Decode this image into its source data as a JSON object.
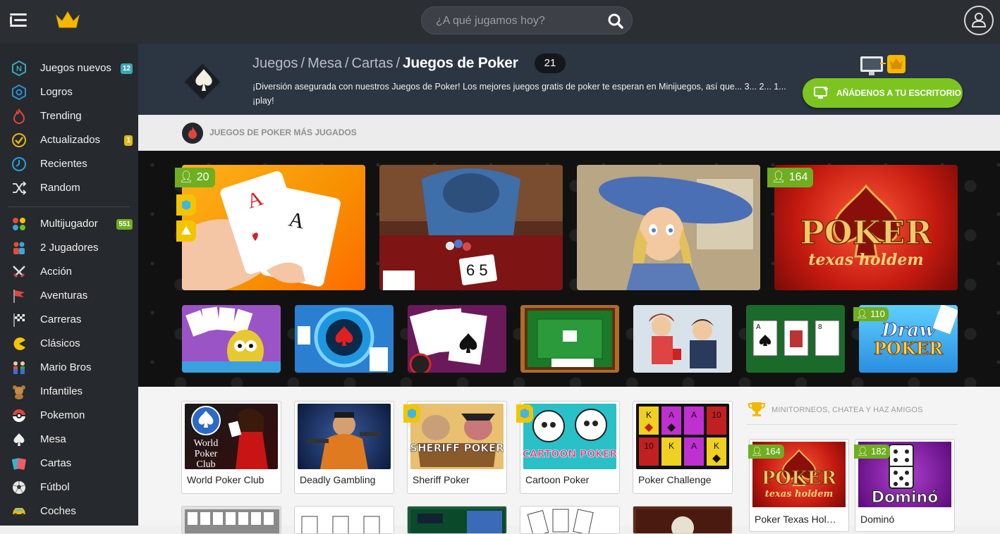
{
  "topbar": {
    "search_placeholder": "¿A qué jugamos hoy?",
    "menu_icon": "hamburger-icon",
    "logo_icon": "crown-logo-icon",
    "user_icon": "user-icon"
  },
  "sidebar": {
    "items": [
      {
        "label": "Juegos nuevos",
        "badge": "12",
        "badge_color": "#3aa7b8",
        "icon": "new-n-icon"
      },
      {
        "label": "Logros",
        "icon": "badge-icon"
      },
      {
        "label": "Trending",
        "icon": "fire-icon"
      },
      {
        "label": "Actualizados",
        "badge": "1",
        "badge_color": "#e2b816",
        "icon": "check-icon"
      },
      {
        "label": "Recientes",
        "icon": "clock-icon"
      },
      {
        "label": "Random",
        "icon": "shuffle-icon"
      },
      {
        "label": "Multijugador",
        "badge": "551",
        "badge_color": "#6fae20",
        "icon": "multiplayer-icon"
      },
      {
        "label": "2 Jugadores",
        "icon": "two-players-icon"
      },
      {
        "label": "Acción",
        "icon": "swords-icon"
      },
      {
        "label": "Aventuras",
        "icon": "flag-icon"
      },
      {
        "label": "Carreras",
        "icon": "checkered-flag-icon"
      },
      {
        "label": "Clásicos",
        "icon": "pacman-icon"
      },
      {
        "label": "Mario Bros",
        "icon": "mario-icon"
      },
      {
        "label": "Infantiles",
        "icon": "teddy-bear-icon"
      },
      {
        "label": "Pokemon",
        "icon": "pokeball-icon"
      },
      {
        "label": "Mesa",
        "icon": "spade-icon"
      },
      {
        "label": "Cartas",
        "icon": "cards-icon"
      },
      {
        "label": "Fútbol",
        "icon": "football-icon"
      },
      {
        "label": "Coches",
        "icon": "car-icon"
      }
    ]
  },
  "header": {
    "breadcrumb": [
      "Juegos",
      "Mesa",
      "Cartas"
    ],
    "breadcrumb_sep": "/",
    "title": "Juegos de Poker",
    "count": "21",
    "description": "¡Diversión asegurada con nuestros Juegos de Poker! Los mejores juegos gratis de poker te esperan en Minijuegos, así que... 3... 2... 1... ¡play!",
    "add_button": "AÑÁDENOS A TU ESCRITORIO"
  },
  "most_played": {
    "title": "JUEGOS DE POKER MÁS JUGADOS",
    "big_cards": [
      {
        "players": "20"
      },
      {},
      {},
      {
        "players": "164",
        "logo_main": "POKER",
        "logo_sub": "texas holdem"
      }
    ],
    "small_cards": [
      {},
      {},
      {},
      {},
      {},
      {},
      {
        "players": "110",
        "logo_main": "Draw",
        "logo_sub": "POKER"
      }
    ]
  },
  "games": [
    {
      "name": "World Poker Club",
      "logo_text": "World Poker Club"
    },
    {
      "name": "Deadly Gambling"
    },
    {
      "name": "Sheriff Poker",
      "logo_text": "SHERIFF POKER"
    },
    {
      "name": "Cartoon Poker",
      "logo_text": "CARTOON POKER"
    },
    {
      "name": "Poker Challenge",
      "cells": [
        "K",
        "A",
        "A",
        "10",
        "10",
        "K",
        "A",
        "K"
      ]
    }
  ],
  "minitorneos": {
    "title": "MINITORNEOS, CHATEA Y HAZ AMIGOS",
    "cards": [
      {
        "name": "Poker Texas Hol…",
        "players": "164",
        "logo_main": "POKER",
        "logo_sub": "texas holdem"
      },
      {
        "name": "Dominó",
        "players": "182",
        "logo_main": "Dominó"
      }
    ]
  },
  "colors": {
    "accent_green": "#7cc520",
    "header_bg": "#2c3542",
    "sidebar_bg": "#26292e"
  }
}
